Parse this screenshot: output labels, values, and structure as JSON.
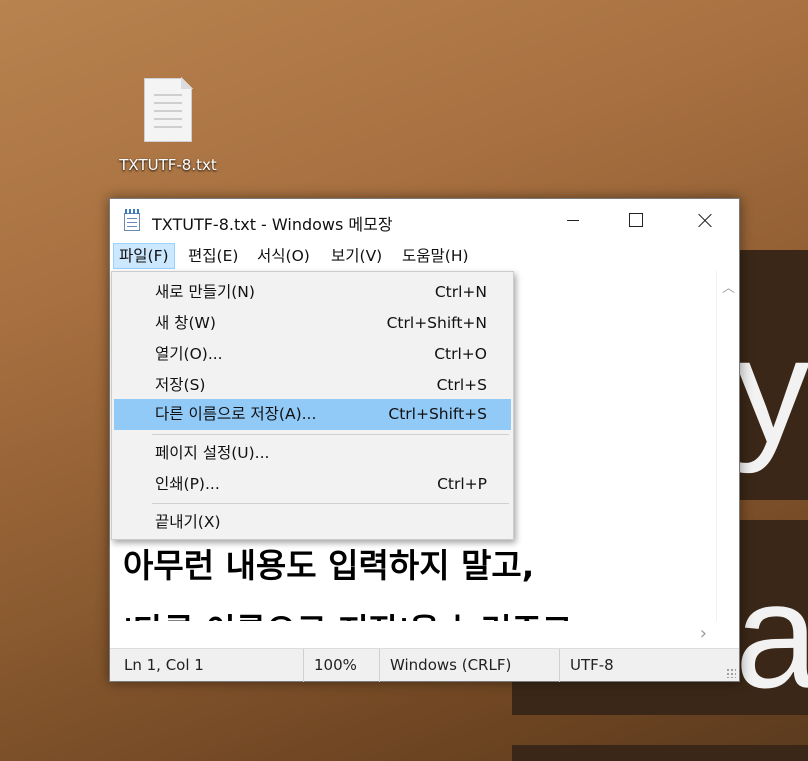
{
  "desktop": {
    "icon_label": "TXTUTF-8.txt"
  },
  "window": {
    "title": "TXTUTF-8.txt - Windows 메모장",
    "menu": {
      "file": "파일(F)",
      "edit": "편집(E)",
      "format": "서식(O)",
      "view": "보기(V)",
      "help": "도움말(H)"
    },
    "editor_lines": [
      "아무런 내용도 입력하지 말고,",
      "'다른 이름으로 저장'을 눌러주고"
    ],
    "status": {
      "position": "Ln 1, Col 1",
      "zoom": "100%",
      "line_ending": "Windows (CRLF)",
      "encoding": "UTF-8"
    }
  },
  "file_menu": {
    "highlighted_index": 4,
    "items": [
      {
        "label": "새로 만들기(N)",
        "shortcut": "Ctrl+N"
      },
      {
        "label": "새 창(W)",
        "shortcut": "Ctrl+Shift+N"
      },
      {
        "label": "열기(O)...",
        "shortcut": "Ctrl+O"
      },
      {
        "label": "저장(S)",
        "shortcut": "Ctrl+S"
      },
      {
        "label": "다른 이름으로 저장(A)...",
        "shortcut": "Ctrl+Shift+S"
      },
      {
        "label": "페이지 설정(U)...",
        "shortcut": ""
      },
      {
        "label": "인쇄(P)...",
        "shortcut": "Ctrl+P"
      },
      {
        "label": "끝내기(X)",
        "shortcut": ""
      }
    ]
  },
  "colors": {
    "menu_highlight": "#91c9f7",
    "menubar_active": "#cce8ff"
  }
}
